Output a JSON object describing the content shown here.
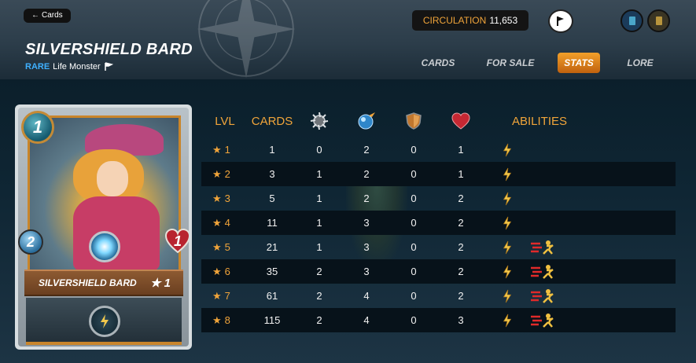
{
  "header": {
    "back_label": "Cards",
    "card_title": "SILVERSHIELD BARD",
    "rarity": "RARE",
    "type_label": "Life Monster",
    "circulation_label": "CIRCULATION",
    "circulation_value": "11,653"
  },
  "tabs": [
    {
      "label": "CARDS",
      "active": false
    },
    {
      "label": "FOR SALE",
      "active": false
    },
    {
      "label": "STATS",
      "active": true
    },
    {
      "label": "LORE",
      "active": false
    }
  ],
  "card": {
    "mana": "1",
    "speed": "2",
    "health": "1",
    "name": "SILVERSHIELD BARD",
    "level": "★ 1"
  },
  "stats": {
    "columns": {
      "lvl": "LVL",
      "cards": "CARDS",
      "abilities": "ABILITIES"
    },
    "column_icons": [
      "attack-icon",
      "speed-icon",
      "armor-icon",
      "health-icon"
    ],
    "rows": [
      {
        "lvl": "1",
        "cards": "1",
        "atk": "0",
        "spd": "2",
        "arm": "0",
        "hp": "1",
        "abilities": [
          "inspire"
        ]
      },
      {
        "lvl": "2",
        "cards": "3",
        "atk": "1",
        "spd": "2",
        "arm": "0",
        "hp": "1",
        "abilities": [
          "inspire"
        ]
      },
      {
        "lvl": "3",
        "cards": "5",
        "atk": "1",
        "spd": "2",
        "arm": "0",
        "hp": "2",
        "abilities": [
          "inspire"
        ]
      },
      {
        "lvl": "4",
        "cards": "11",
        "atk": "1",
        "spd": "3",
        "arm": "0",
        "hp": "2",
        "abilities": [
          "inspire"
        ]
      },
      {
        "lvl": "5",
        "cards": "21",
        "atk": "1",
        "spd": "3",
        "arm": "0",
        "hp": "2",
        "abilities": [
          "inspire",
          "swiftness"
        ]
      },
      {
        "lvl": "6",
        "cards": "35",
        "atk": "2",
        "spd": "3",
        "arm": "0",
        "hp": "2",
        "abilities": [
          "inspire",
          "swiftness"
        ]
      },
      {
        "lvl": "7",
        "cards": "61",
        "atk": "2",
        "spd": "4",
        "arm": "0",
        "hp": "2",
        "abilities": [
          "inspire",
          "swiftness"
        ]
      },
      {
        "lvl": "8",
        "cards": "115",
        "atk": "2",
        "spd": "4",
        "arm": "0",
        "hp": "3",
        "abilities": [
          "inspire",
          "swiftness"
        ]
      }
    ]
  },
  "colors": {
    "accent_orange": "#f0a43a",
    "rare_blue": "#3fb0ff",
    "row_dark": "#07121a"
  }
}
